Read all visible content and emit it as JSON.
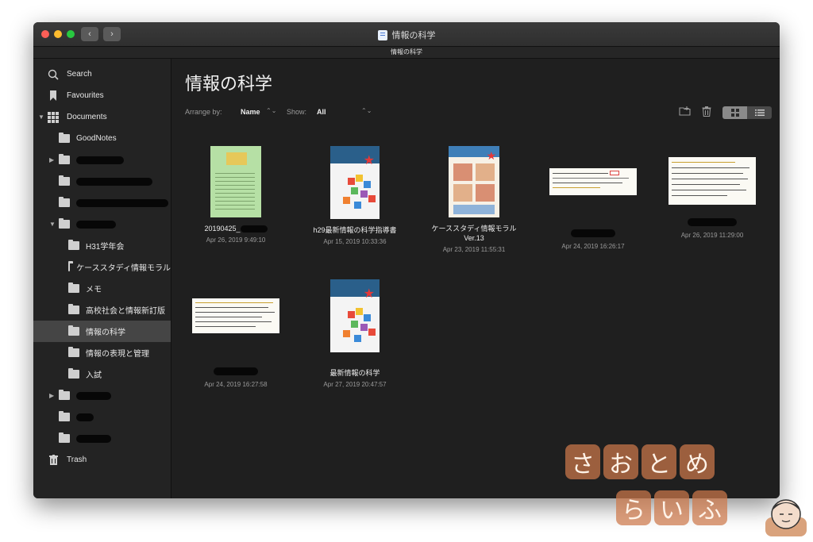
{
  "window": {
    "title": "情報の科学",
    "tab_label": "情報の科学",
    "back_glyph": "‹",
    "forward_glyph": "›"
  },
  "sidebar": {
    "search": "Search",
    "favourites": "Favourites",
    "documents": "Documents",
    "folders": {
      "goodnotes": "GoodNotes",
      "sub": [
        {
          "label": "H31学年会"
        },
        {
          "label": "ケーススタディ情報モラル"
        },
        {
          "label": "メモ"
        },
        {
          "label": "高校社会と情報新訂版"
        },
        {
          "label": "情報の科学"
        },
        {
          "label": "情報の表現と管理"
        },
        {
          "label": "入試"
        }
      ]
    },
    "trash": "Trash"
  },
  "main": {
    "title": "情報の科学",
    "arrange_label": "Arrange by:",
    "arrange_value": "Name",
    "show_label": "Show:",
    "show_value": "All",
    "sort_chevron": "⌃⌄"
  },
  "documents": [
    {
      "name": "20190425_",
      "date": "Apr 26, 2019 9:49:10"
    },
    {
      "name": "h29最新情報の科学指導書",
      "date": "Apr 15, 2019 10:33:36"
    },
    {
      "name": "ケーススタディ情報モラル Ver.13",
      "date": "Apr 23, 2019 11:55:31"
    },
    {
      "name": "",
      "date": "Apr 24, 2019 16:26:17"
    },
    {
      "name": "",
      "date": "Apr 26, 2019 11:29:00"
    },
    {
      "name": "",
      "date": "Apr 24, 2019 16:27:58"
    },
    {
      "name": "最新情報の科学",
      "date": "Apr 27, 2019 20:47:57"
    }
  ],
  "watermark": {
    "row1": [
      "さ",
      "お",
      "と",
      "め"
    ],
    "row2": [
      "ら",
      "い",
      "ふ"
    ]
  },
  "icons": {
    "search": "search-icon",
    "bookmark": "bookmark-icon",
    "grid": "grid-icon",
    "folder": "folder-icon",
    "trash": "trash-icon",
    "new_folder": "new-folder-icon",
    "delete": "delete-icon",
    "list": "list-view-icon"
  },
  "colors": {
    "close": "#fd5f57",
    "minimize": "#febc2e",
    "maximize": "#28c840",
    "selection": "#454545",
    "watermark": "#cd784b"
  }
}
